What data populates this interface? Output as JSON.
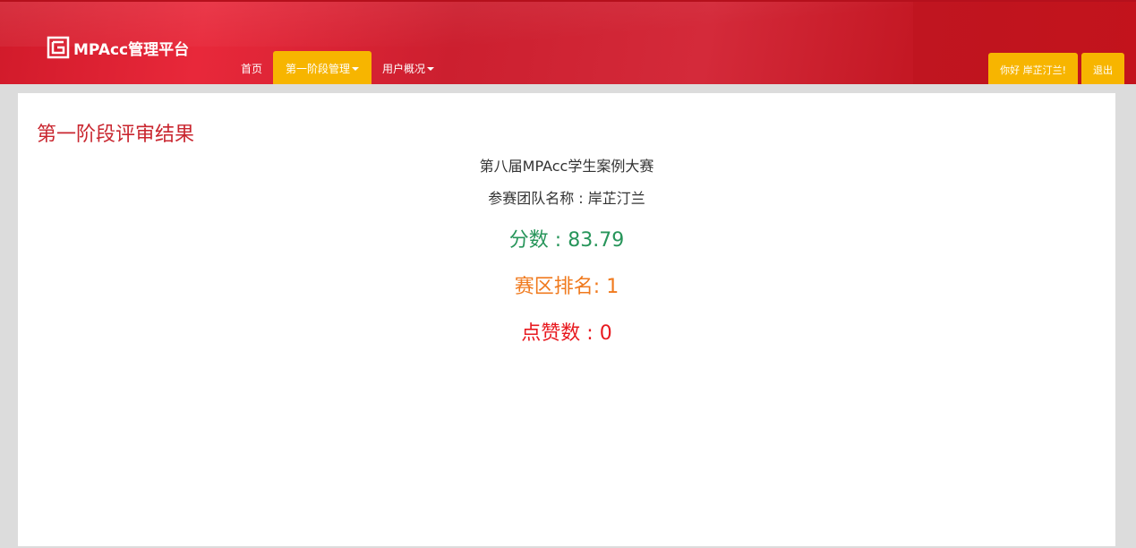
{
  "header": {
    "logo_text": "MPAcc管理平台",
    "nav": [
      {
        "label": "首页"
      },
      {
        "label": "第一阶段管理"
      },
      {
        "label": "用户概况"
      }
    ],
    "greeting": "你好 岸芷汀兰!",
    "logout": "退出"
  },
  "main": {
    "title": "第一阶段评审结果",
    "contest_name": "第八届MPAcc学生案例大赛",
    "team_label": "参赛团队名称 : ",
    "team_name": "岸芷汀兰",
    "score_label": "分数 : ",
    "score_value": "83.79",
    "rank_label": "赛区排名: ",
    "rank_value": "1",
    "likes_label": "点赞数 : ",
    "likes_value": "0"
  },
  "colors": {
    "brand_red": "#d11a2a",
    "accent_yellow": "#f7b500",
    "title_red": "#c9262f",
    "score_green": "#27955a",
    "rank_orange": "#f07a1e",
    "likes_red": "#e8191f"
  }
}
